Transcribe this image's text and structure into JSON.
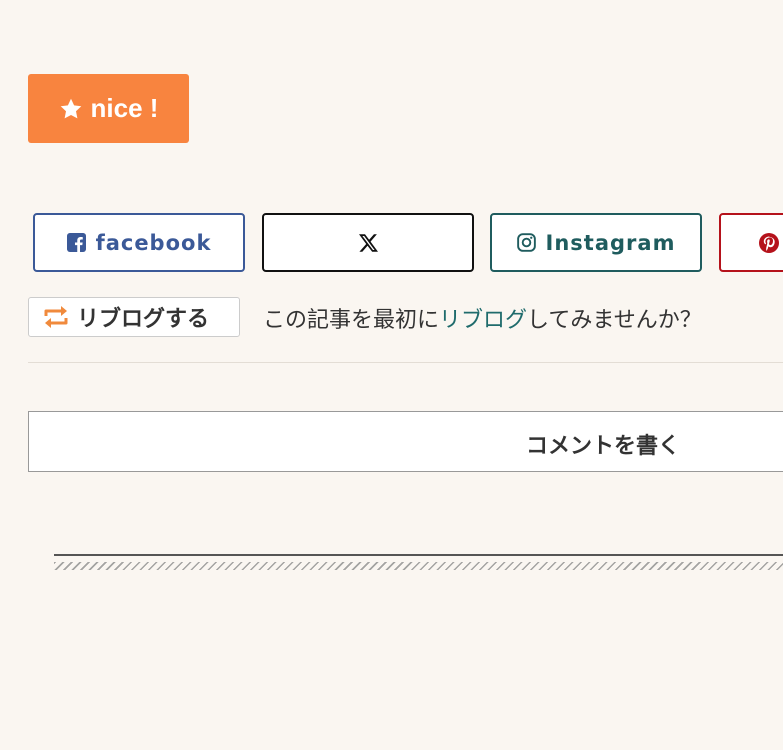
{
  "nice": {
    "label": "nice !"
  },
  "share": {
    "facebook": "facebook",
    "x": "𝕏",
    "instagram": "Instagram"
  },
  "reblog": {
    "button_label": "リブログする",
    "prompt_before": "この記事を最初に",
    "prompt_link": "リブログ",
    "prompt_after": "してみませんか？"
  },
  "comment": {
    "label": "コメントを書く"
  },
  "colors": {
    "background": "#faf6f1",
    "nice": "#f8843f",
    "facebook": "#3b5998",
    "instagram": "#1f5c5e",
    "pinterest": "#b5121b",
    "link": "#1f6b6c"
  },
  "icons": [
    "star-icon",
    "facebook-icon",
    "x-icon",
    "instagram-icon",
    "pinterest-icon",
    "reblog-icon"
  ]
}
